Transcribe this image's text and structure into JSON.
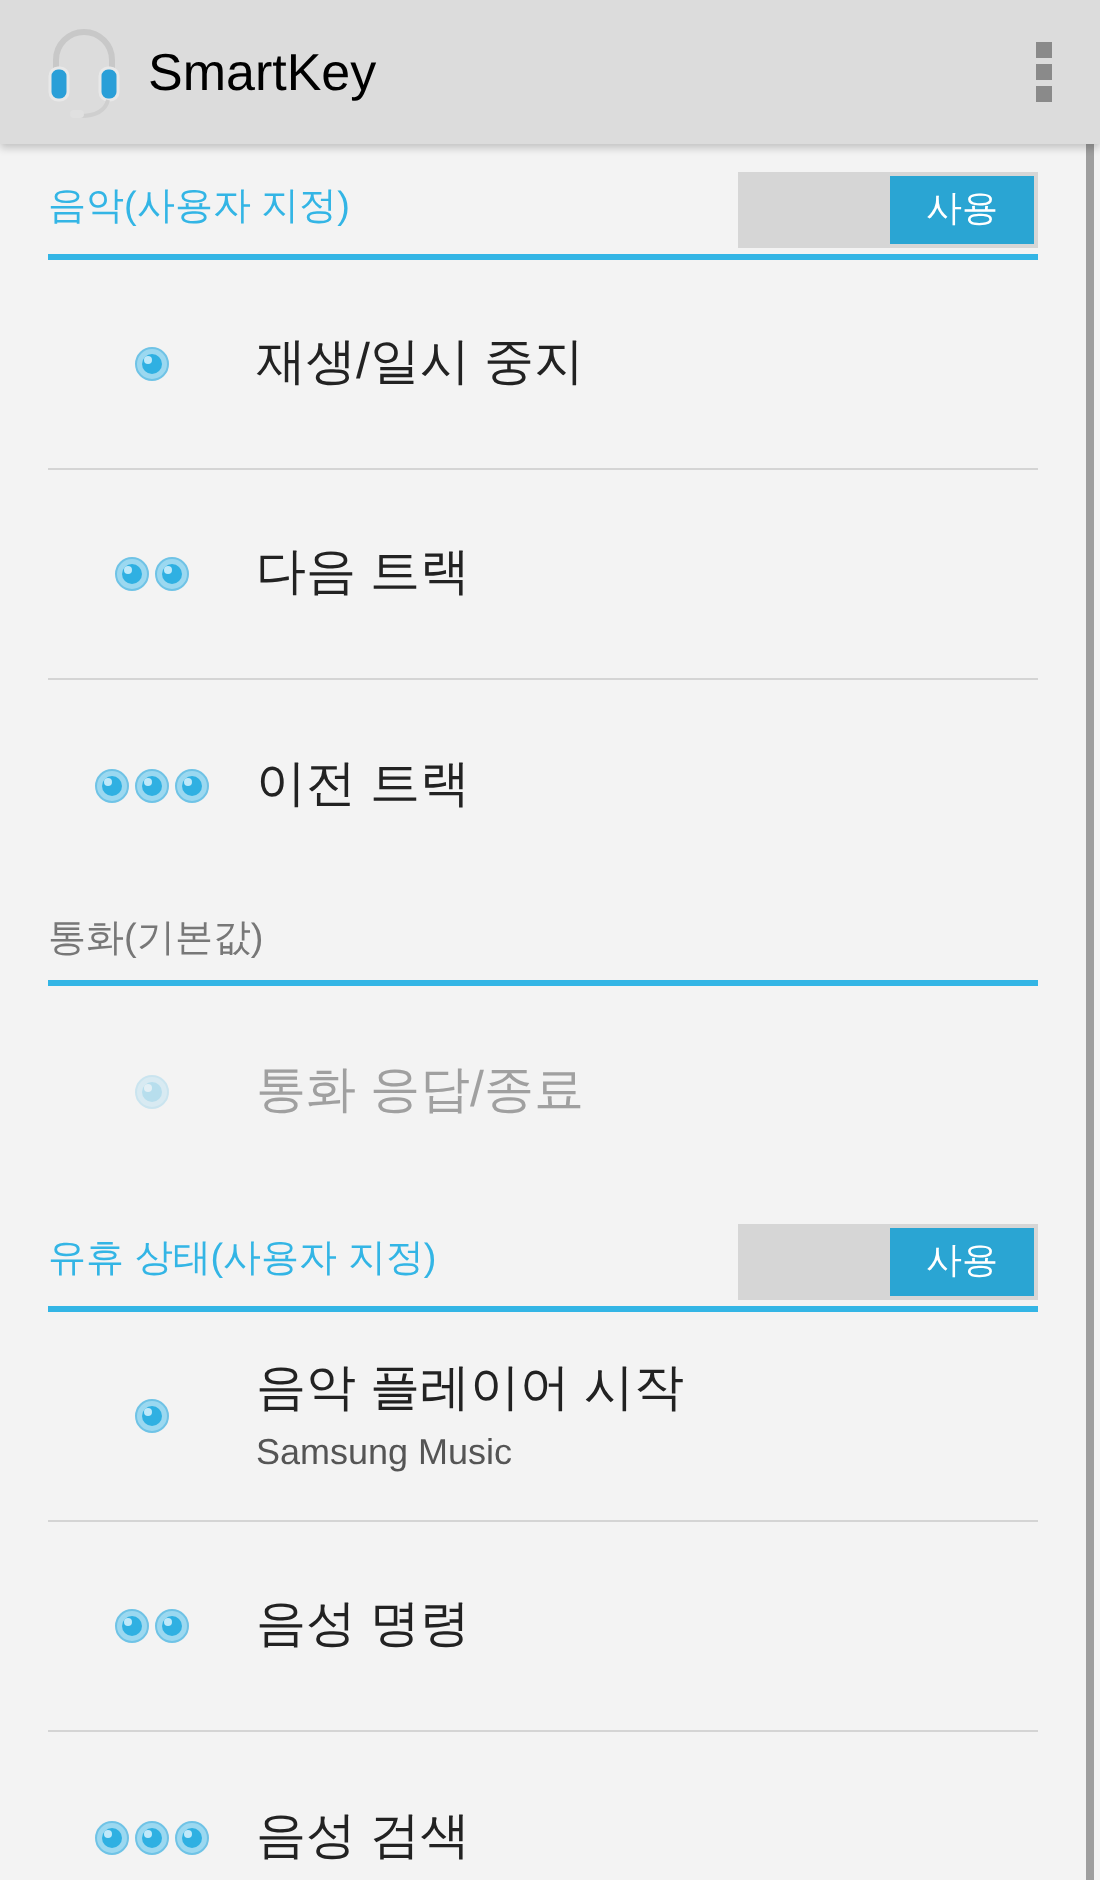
{
  "app_bar": {
    "title": "SmartKey"
  },
  "sections": [
    {
      "title": "음악(사용자 지정)",
      "kind": "custom",
      "toggle": {
        "label": "사용",
        "on": true
      },
      "items": [
        {
          "label": "재생/일시 중지",
          "kind": "single",
          "disabled": false
        },
        {
          "label": "다음 트랙",
          "kind": "double",
          "disabled": false
        },
        {
          "label": "이전 트랙",
          "kind": "triple",
          "disabled": false
        }
      ]
    },
    {
      "title": "통화(기본값)",
      "kind": "default",
      "items": [
        {
          "label": "통화 응답/종료",
          "kind": "single",
          "disabled": true
        }
      ]
    },
    {
      "title": "유휴 상태(사용자 지정)",
      "kind": "custom",
      "toggle": {
        "label": "사용",
        "on": true
      },
      "items": [
        {
          "label": "음악 플레이어 시작",
          "subtitle": "Samsung Music",
          "kind": "single",
          "disabled": false
        },
        {
          "label": "음성 명령",
          "kind": "double",
          "disabled": false
        },
        {
          "label": "음성 검색",
          "kind": "triple",
          "disabled": false
        }
      ]
    }
  ]
}
